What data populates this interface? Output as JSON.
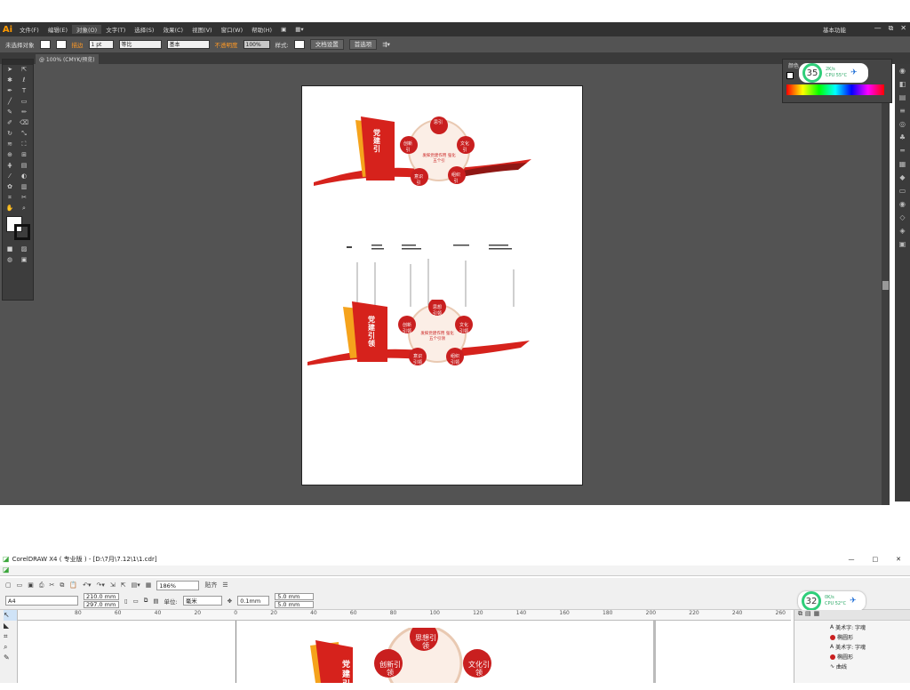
{
  "illustrator": {
    "logo": "Ai",
    "menus": [
      "文件(F)",
      "编辑(E)",
      "对象(O)",
      "文字(T)",
      "选择(S)",
      "效果(C)",
      "视图(V)",
      "窗口(W)",
      "帮助(H)"
    ],
    "workspace": "基本功能",
    "window_controls": [
      "—",
      "⧉",
      "✕"
    ],
    "control": {
      "selection": "未选择对象",
      "stroke_label": "描边",
      "stroke_value": "1 pt",
      "brush1": "等比",
      "brush2": "基本",
      "opacity_label": "不透明度",
      "opacity_value": "100%",
      "style_label": "样式:",
      "doc_settings": "文档设置",
      "preferences": "首选项"
    },
    "doc_tab": "@ 100% (CMYK/预览)",
    "panel_title": "颜色",
    "cpu": {
      "percent": "35",
      "speed": "2K/s",
      "temp": "CPU 55°C"
    },
    "design_top": {
      "flag_text": "党建引",
      "circles": [
        "思引",
        "文化引",
        "组织引",
        "意识引",
        "创新引"
      ],
      "center": "发挥党建作用 强化五个引"
    },
    "design_bottom": {
      "flag_text": "党建引领",
      "circles": [
        "思想引领",
        "文化引领",
        "组织引领",
        "意识引领",
        "创新引领"
      ],
      "center": "发挥党建作用 强化五个引领"
    }
  },
  "corel": {
    "title": "CorelDRAW X4 ( 专业版 ) - [D:\\7月\\7.12\\1\\1.cdr]",
    "window_controls": [
      "—",
      "□",
      "✕"
    ],
    "zoom": "186%",
    "snap": "贴齐",
    "paper": "A4",
    "width": "210.0 mm",
    "height": "297.0 mm",
    "unit_label": "单位:",
    "unit": "毫米",
    "nudge": "0.1mm",
    "dup_x": "5.0 mm",
    "dup_y": "5.0 mm",
    "ruler_ticks": [
      "80",
      "60",
      "40",
      "20",
      "0",
      "20",
      "40",
      "60",
      "80",
      "100",
      "120",
      "140",
      "160",
      "180",
      "200",
      "220",
      "240",
      "260"
    ],
    "cpu": {
      "percent": "32",
      "speed": "0K/s",
      "temp": "CPU 52°C"
    },
    "objects": [
      "美术字: 字魂",
      "椭圆形",
      "美术字: 字魂",
      "椭圆形",
      "曲线"
    ],
    "design_circles": [
      "思想引领",
      "创新引领",
      "文化引领"
    ],
    "design_flag": "党建引"
  }
}
